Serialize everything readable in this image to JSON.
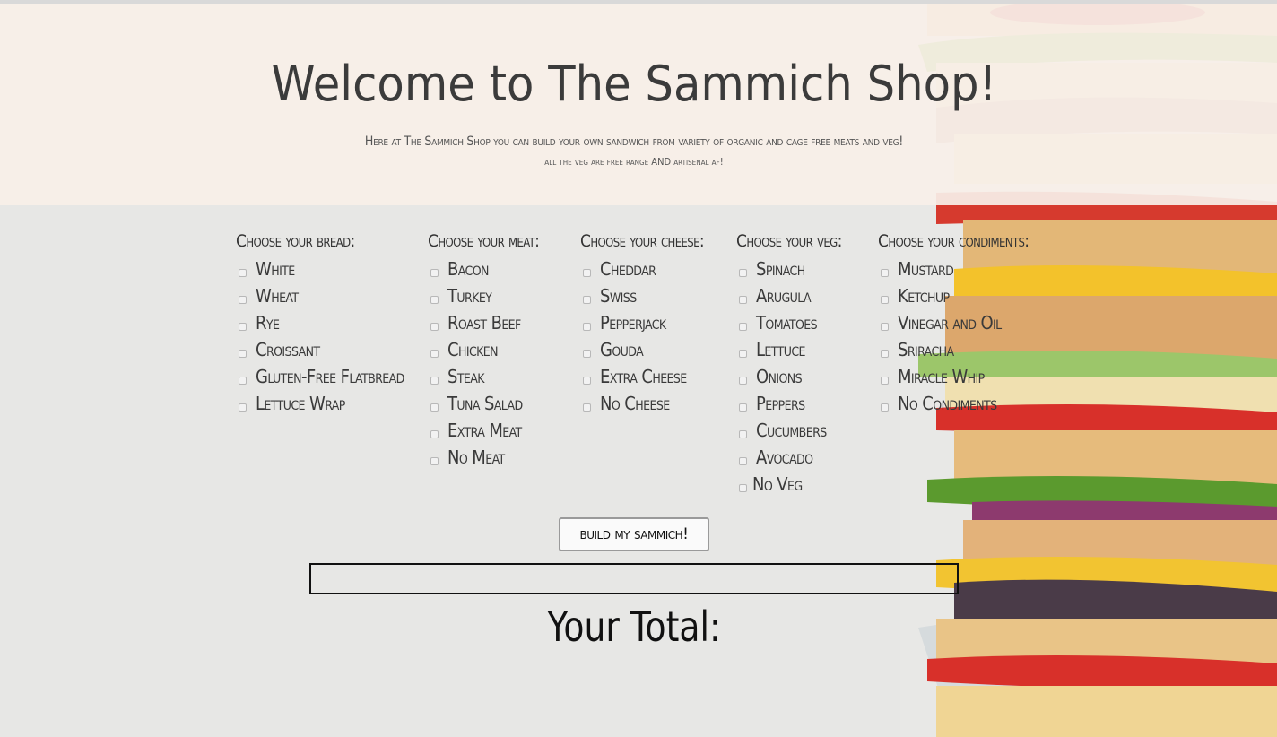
{
  "hero": {
    "title": "Welcome to The Sammich Shop!",
    "subtitle": "Here at The Sammich Shop you can build your own sandwich from variety of organic and cage free meats and veg!",
    "subtitle2": "all the veg are free range AND artisenal af!"
  },
  "columns": [
    {
      "heading": "Choose your bread:",
      "options": [
        "White",
        "Wheat",
        "Rye",
        "Croissant",
        "Gluten-Free Flatbread",
        "Lettuce Wrap"
      ]
    },
    {
      "heading": "Choose your meat:",
      "options": [
        "Bacon",
        "Turkey",
        "Roast Beef",
        "Chicken",
        "Steak",
        "Tuna Salad",
        "Extra Meat",
        "No Meat"
      ]
    },
    {
      "heading": "Choose your cheese:",
      "options": [
        "Cheddar",
        "Swiss",
        "Pepperjack",
        "Gouda",
        "Extra Cheese",
        "No Cheese"
      ]
    },
    {
      "heading": "Choose your veg:",
      "options": [
        "Spinach",
        "Arugula",
        "Tomatoes",
        "Lettuce",
        "Onions",
        "Peppers",
        "Cucumbers",
        "Avocado",
        "No Veg"
      ]
    },
    {
      "heading": "Choose your condiments:",
      "options": [
        "Mustard",
        "Ketchup",
        "Vinegar and Oil",
        "Sriracha",
        "Miracle Whip",
        "No Condiments"
      ]
    }
  ],
  "build_button": "build my sammich!",
  "total_label": "Your Total:"
}
